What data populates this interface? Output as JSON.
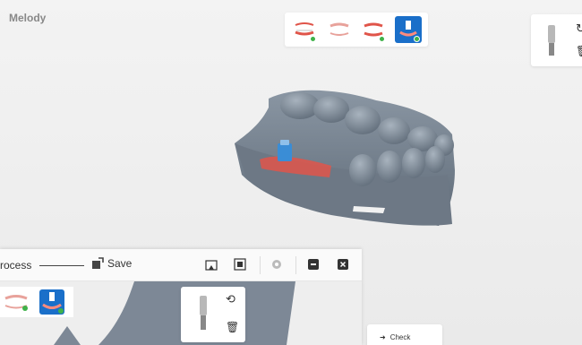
{
  "app": {
    "title": "Melody"
  },
  "stage_toolbar": {
    "stages": [
      {
        "icon": "lower-jaw-scan-icon",
        "active": false,
        "complete": true
      },
      {
        "icon": "upper-jaw-scan-icon",
        "active": false,
        "complete": false
      },
      {
        "icon": "bite-scan-icon",
        "active": false,
        "complete": true
      },
      {
        "icon": "implant-scan-icon",
        "active": true,
        "complete": true
      }
    ]
  },
  "implant_panel": {
    "icons": [
      "scan-body-icon",
      "rotate-icon",
      "delete-icon"
    ]
  },
  "process_window": {
    "process_label": "rocess",
    "save_label": "Save",
    "header_icons": [
      "snapshot-icon",
      "view-icon",
      "settings-icon",
      "minimize-icon",
      "close-icon"
    ],
    "mini_implant_icons": [
      "scan-body-icon",
      "zoom-refresh-icon",
      "delete-icon"
    ]
  },
  "check_panel": {
    "label": "Check"
  },
  "colors": {
    "accent": "#1a6fc9",
    "complete": "#3fb24a",
    "scan_gray": "#7d8896",
    "scan_red": "#e0554a"
  }
}
